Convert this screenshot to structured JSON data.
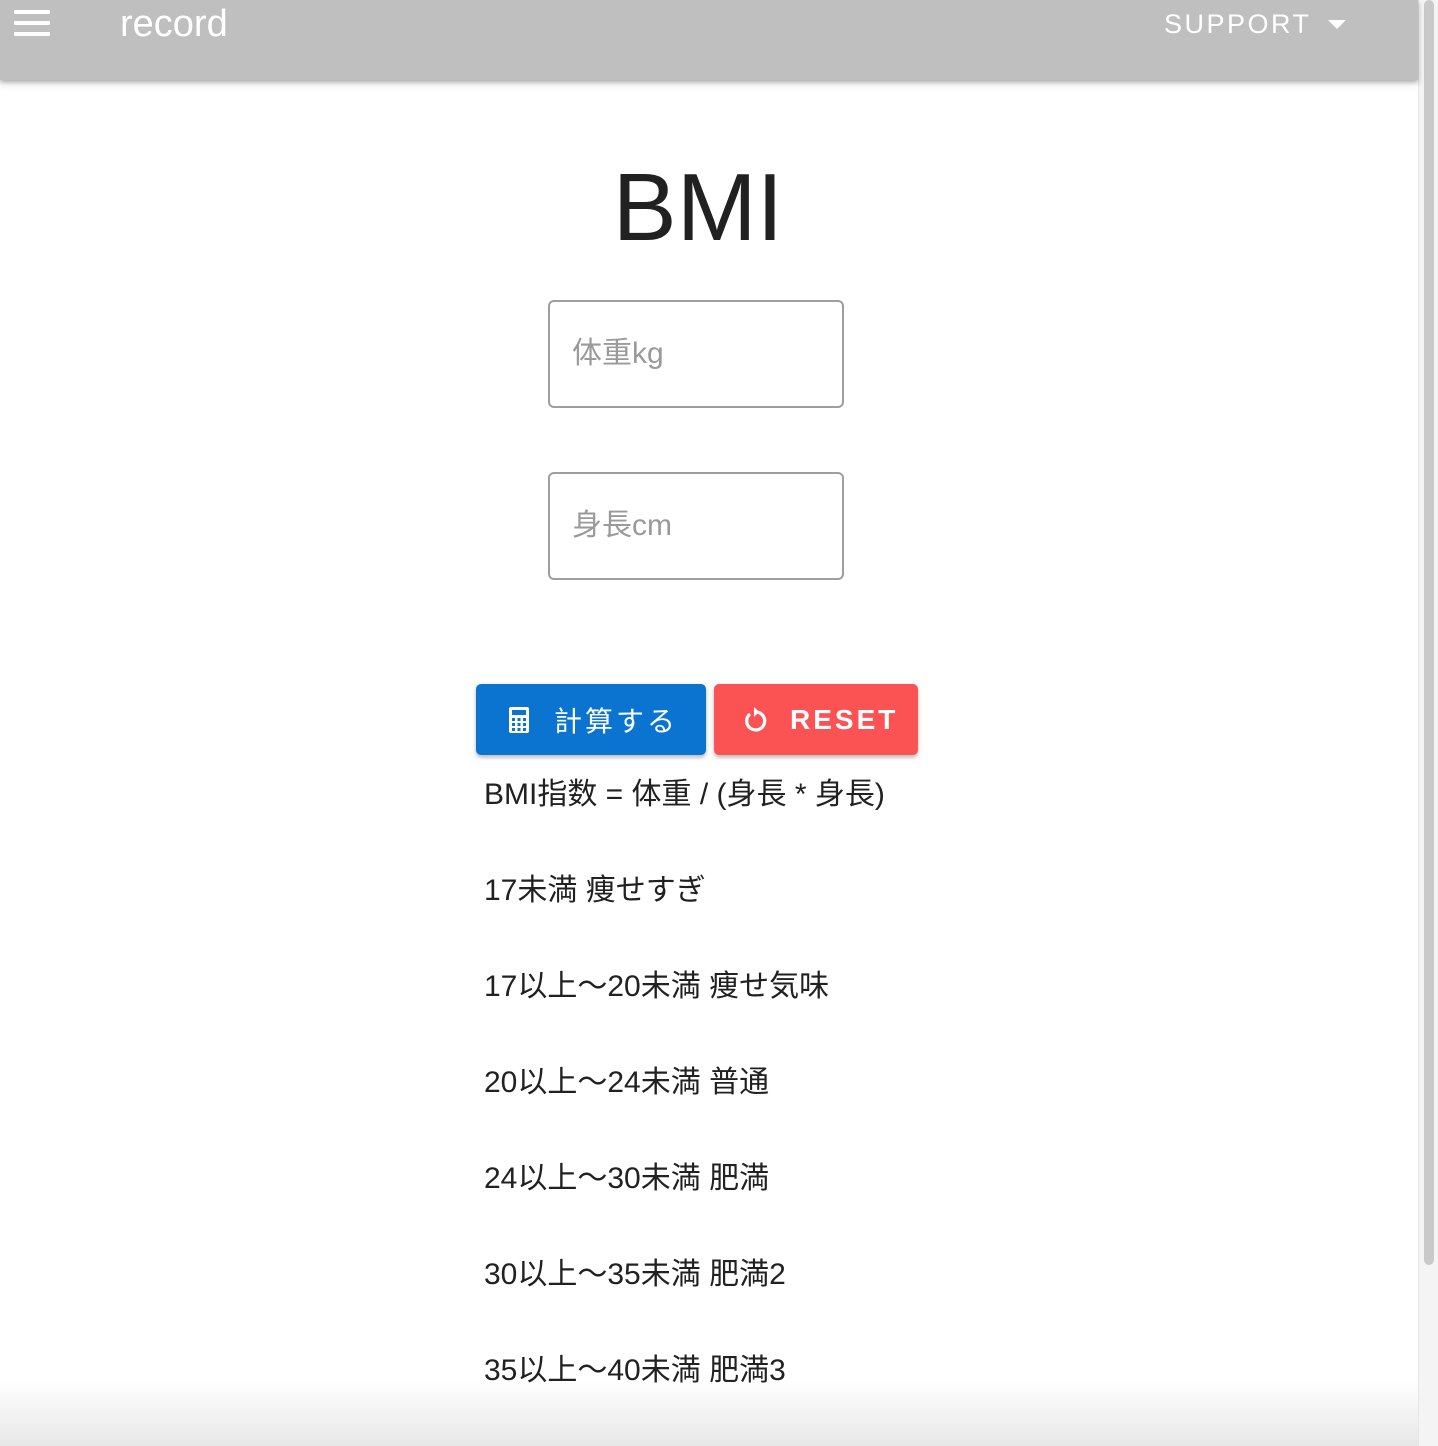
{
  "appbar": {
    "title": "record",
    "menu_icon": "hamburger-menu-icon",
    "support_label": "SUPPORT",
    "support_icon": "caret-down-icon",
    "background": "#bfbfbf"
  },
  "main": {
    "title": "BMI",
    "weight_placeholder": "体重kg",
    "weight_value": "",
    "height_placeholder": "身長cm",
    "height_value": "",
    "calc_button": {
      "label": "計算する",
      "icon": "calculator-icon",
      "color": "#0b74d1"
    },
    "reset_button": {
      "label": "RESET",
      "icon": "restart-icon",
      "color": "#fb5353"
    },
    "formula": "BMI指数 = 体重 / (身長 * 身長)",
    "categories": [
      "17未満 痩せすぎ",
      "17以上～20未満 痩せ気味",
      "20以上～24未満 普通",
      "24以上～30未満 肥満",
      "30以上～35未満 肥満2",
      "35以上～40未満 肥満3"
    ]
  }
}
